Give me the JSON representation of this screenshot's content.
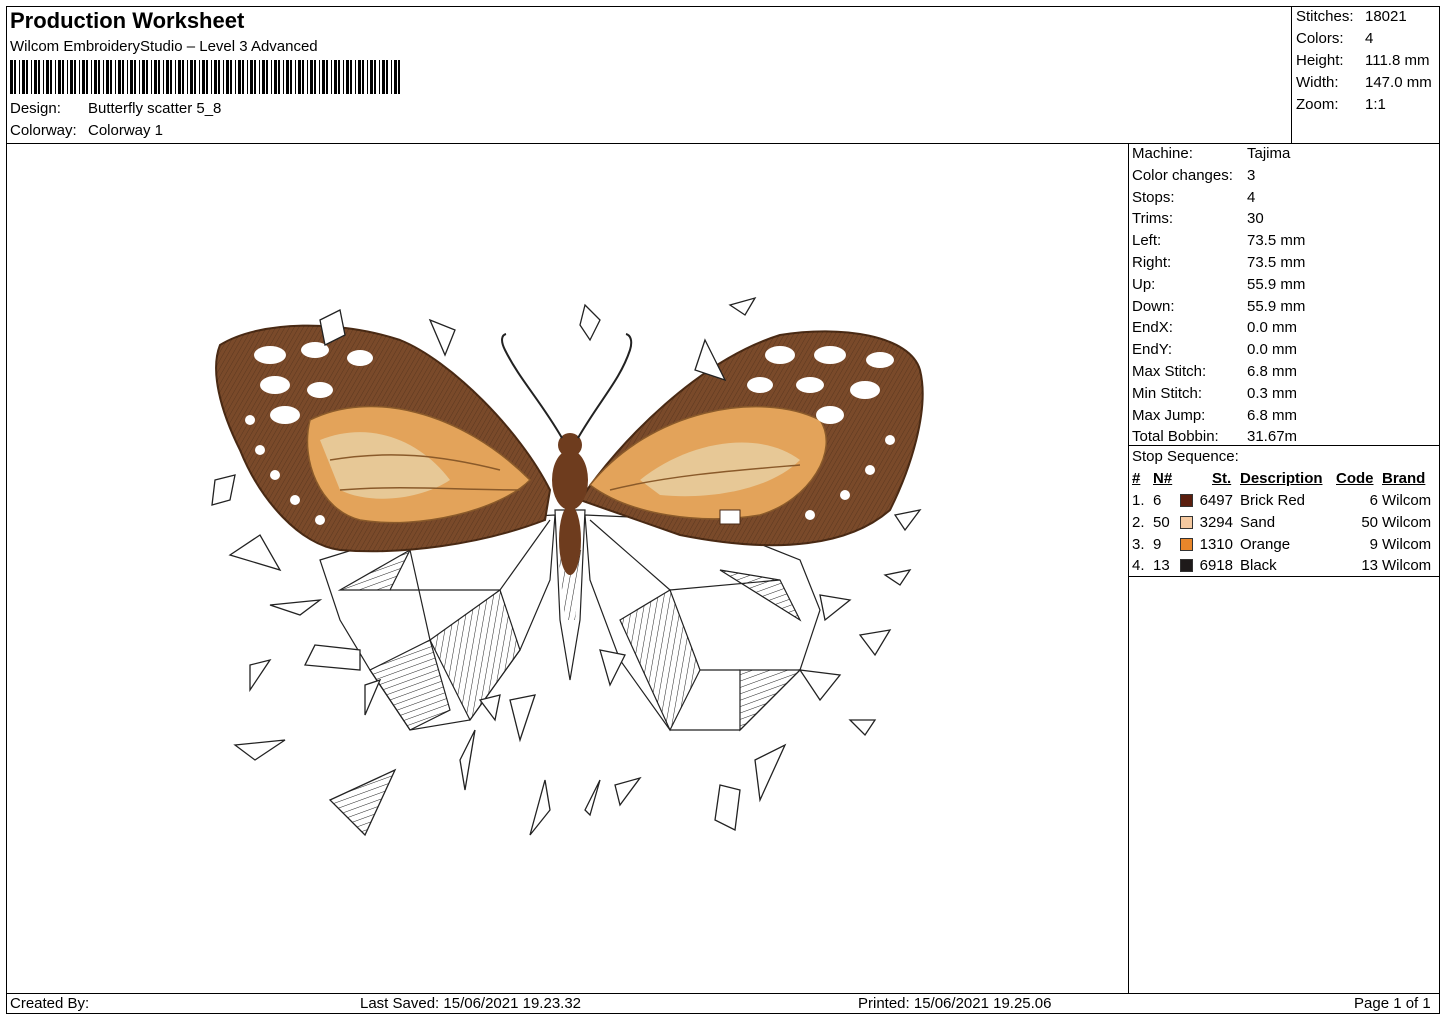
{
  "header": {
    "title": "Production Worksheet",
    "software": "Wilcom EmbroideryStudio – Level 3 Advanced",
    "design_label": "Design:",
    "design_value": "Butterfly scatter 5_8",
    "colorway_label": "Colorway:",
    "colorway_value": "Colorway 1"
  },
  "summary": [
    {
      "label": "Stitches:",
      "value": "18021"
    },
    {
      "label": "Colors:",
      "value": "4"
    },
    {
      "label": "Height:",
      "value": "111.8 mm"
    },
    {
      "label": "Width:",
      "value": "147.0 mm"
    },
    {
      "label": "Zoom:",
      "value": "1:1"
    }
  ],
  "machine_info": [
    {
      "label": "Machine:",
      "value": "Tajima"
    },
    {
      "label": "Color changes:",
      "value": "3"
    },
    {
      "label": "Stops:",
      "value": "4"
    },
    {
      "label": "Trims:",
      "value": "30"
    },
    {
      "label": "Left:",
      "value": "73.5 mm"
    },
    {
      "label": "Right:",
      "value": "73.5 mm"
    },
    {
      "label": "Up:",
      "value": "55.9 mm"
    },
    {
      "label": "Down:",
      "value": "55.9 mm"
    },
    {
      "label": "EndX:",
      "value": "0.0 mm"
    },
    {
      "label": "EndY:",
      "value": "0.0 mm"
    },
    {
      "label": "Max Stitch:",
      "value": "6.8 mm"
    },
    {
      "label": "Min Stitch:",
      "value": "0.3 mm"
    },
    {
      "label": "Max Jump:",
      "value": "6.8 mm"
    },
    {
      "label": "Total Bobbin:",
      "value": "31.67m"
    }
  ],
  "stop_sequence": {
    "title": "Stop Sequence:",
    "headers": {
      "num": "#",
      "n": "N#",
      "st": "St.",
      "desc": "Description",
      "code": "Code",
      "brand": "Brand"
    },
    "rows": [
      {
        "num": "1.",
        "n": "6",
        "color": "#5a1e0e",
        "st": "6497",
        "desc": "Brick Red",
        "code": "6",
        "brand": "Wilcom"
      },
      {
        "num": "2.",
        "n": "50",
        "color": "#f5c9a0",
        "st": "3294",
        "desc": "Sand",
        "code": "50",
        "brand": "Wilcom"
      },
      {
        "num": "3.",
        "n": "9",
        "color": "#e8862a",
        "st": "1310",
        "desc": "Orange",
        "code": "9",
        "brand": "Wilcom"
      },
      {
        "num": "4.",
        "n": "13",
        "color": "#1e1a1a",
        "st": "6918",
        "desc": "Black",
        "code": "13",
        "brand": "Wilcom"
      }
    ]
  },
  "footer": {
    "created_by": "Created By:",
    "last_saved": "Last Saved: 15/06/2021 19.23.32",
    "printed": "Printed: 15/06/2021 19.25.06",
    "page": "Page 1 of 1"
  },
  "colors": {
    "brown_wing": "#7a4a2a",
    "orange_wing": "#e3a35a",
    "sand_wing": "#e7c896"
  },
  "design_preview": {
    "subject": "butterfly-embroidery-preview"
  }
}
